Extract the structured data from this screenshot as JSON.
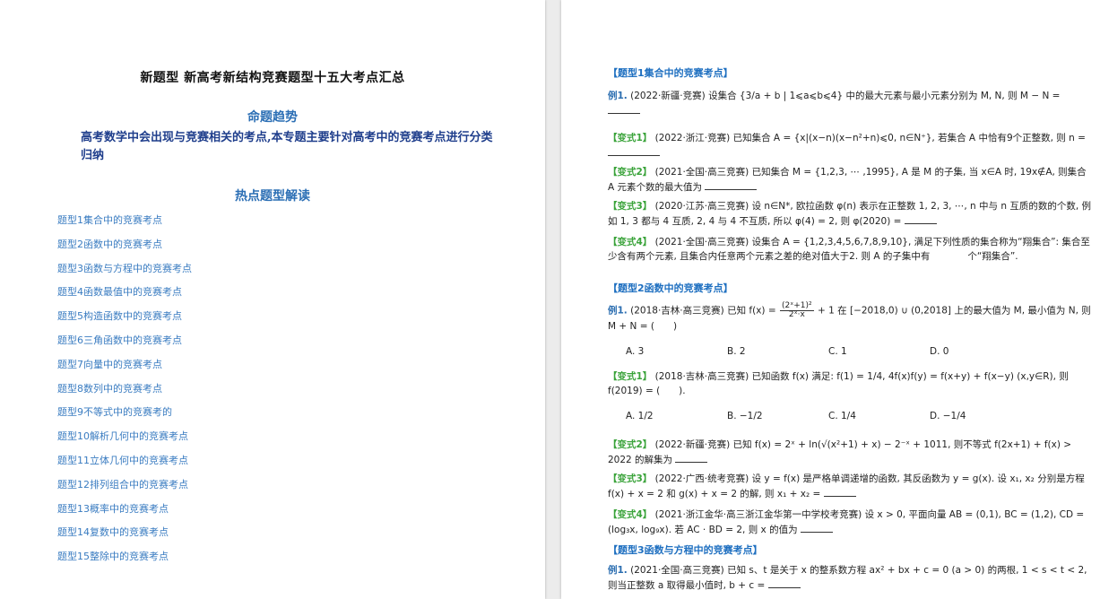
{
  "left": {
    "title": "新题型 新高考新结构竞赛题型十五大考点汇总",
    "trend_heading": "命题趋势",
    "trend_text": "高考数学中会出现与竞赛相关的考点,本专题主要针对高考中的竞赛考点进行分类归纳",
    "hot_heading": "热点题型解读",
    "toc": [
      "题型1集合中的竞赛考点",
      "题型2函数中的竞赛考点",
      "题型3函数与方程中的竞赛考点",
      "题型4函数最值中的竞赛考点",
      "题型5构造函数中的竞赛考点",
      "题型6三角函数中的竞赛考点",
      "题型7向量中的竞赛考点",
      "题型8数列中的竞赛考点",
      "题型9不等式中的竞赛考的",
      "题型10解析几何中的竞赛考点",
      "题型11立体几何中的竞赛考点",
      "题型12排列组合中的竞赛考点",
      "题型13概率中的竞赛考点",
      "题型14复数中的竞赛考点",
      "题型15整除中的竞赛考点"
    ]
  },
  "right": {
    "h1": "【题型1集合中的竞赛考点】",
    "h2": "【题型2函数中的竞赛考点】",
    "h3": "【题型3函数与方程中的竞赛考点】",
    "ex_label": "例1.",
    "v1": "【变式1】",
    "v2": "【变式2】",
    "v3": "【变式3】",
    "v4": "【变式4】",
    "s1_ex1_a": "(2022·新疆·竞赛) 设集合",
    "s1_ex1_set": "{3/a + b | 1⩽a⩽b⩽4}",
    "s1_ex1_b": "中的最大元素与最小元素分别为 M, N, 则 M − N =",
    "s1_v1": "(2022·浙江·竞赛) 已知集合 A = {x|(x−n)(x−n²+n)⩽0, n∈N⁺}, 若集合 A 中恰有9个正整数, 则 n =",
    "s1_v2": "(2021·全国·高三竞赛) 已知集合 M = {1,2,3, ⋯ ,1995}, A 是 M 的子集, 当 x∈A 时, 19x∉A, 则集合 A 元素个数的最大值为",
    "s1_v3": "(2020·江苏·高三竞赛) 设 n∈N*, 欧拉函数 φ(n) 表示在正整数 1, 2, 3, ⋯, n 中与 n 互质的数的个数, 例如 1, 3 都与 4 互质, 2, 4 与 4 不互质, 所以 φ(4) = 2, 则 φ(2020) =",
    "s1_v4": "(2021·全国·高三竞赛) 设集合 A = {1,2,3,4,5,6,7,8,9,10}, 满足下列性质的集合称为“翔集合”: 集合至少含有两个元素, 且集合内任意两个元素之差的绝对值大于2. 则 A 的子集中有　　　　个“翔集合”.",
    "s2_ex1_a": "(2018·吉林·高三竞赛) 已知",
    "s2_ex1_fx": "f(x) =",
    "s2_ex1_num": "(2ˣ+1)²",
    "s2_ex1_den": "2ˣ·x",
    "s2_ex1_b": "+ 1 在 [−2018,0) ∪ (0,2018] 上的最大值为 M, 最小值为 N, 则 M + N = (　　)",
    "s2_ex1_opts": [
      "A. 3",
      "B. 2",
      "C. 1",
      "D. 0"
    ],
    "s2_v1": "(2018·吉林·高三竞赛) 已知函数 f(x) 满足: f(1) = 1/4, 4f(x)f(y) = f(x+y) + f(x−y) (x,y∈R), 则 f(2019) = (　　).",
    "s2_v1_opts": [
      "A. 1/2",
      "B. −1/2",
      "C. 1/4",
      "D. −1/4"
    ],
    "s2_v2": "(2022·新疆·竞赛) 已知 f(x) = 2ˣ + ln(√(x²+1) + x) − 2⁻ˣ + 1011, 则不等式 f(2x+1) + f(x) > 2022 的解集为",
    "s2_v3": "(2022·广西·统考竞赛) 设 y = f(x) 是严格单调递增的函数, 其反函数为 y = g(x). 设 x₁, x₂ 分别是方程 f(x) + x = 2 和 g(x) + x = 2 的解, 则 x₁ + x₂ =",
    "s2_v4": "(2021·浙江金华·高三浙江金华第一中学校考竞赛) 设 x > 0, 平面向量 AB = (0,1), BC = (1,2), CD = (log₃x, log₉x). 若 AC · BD = 2, 则 x 的值为",
    "s3_ex1": "(2021·全国·高三竞赛) 已知 s、t 是关于 x 的整系数方程 ax² + bx + c = 0 (a > 0) 的两根, 1 < s < t < 2, 则当正整数 a 取得最小值时, b + c ="
  }
}
